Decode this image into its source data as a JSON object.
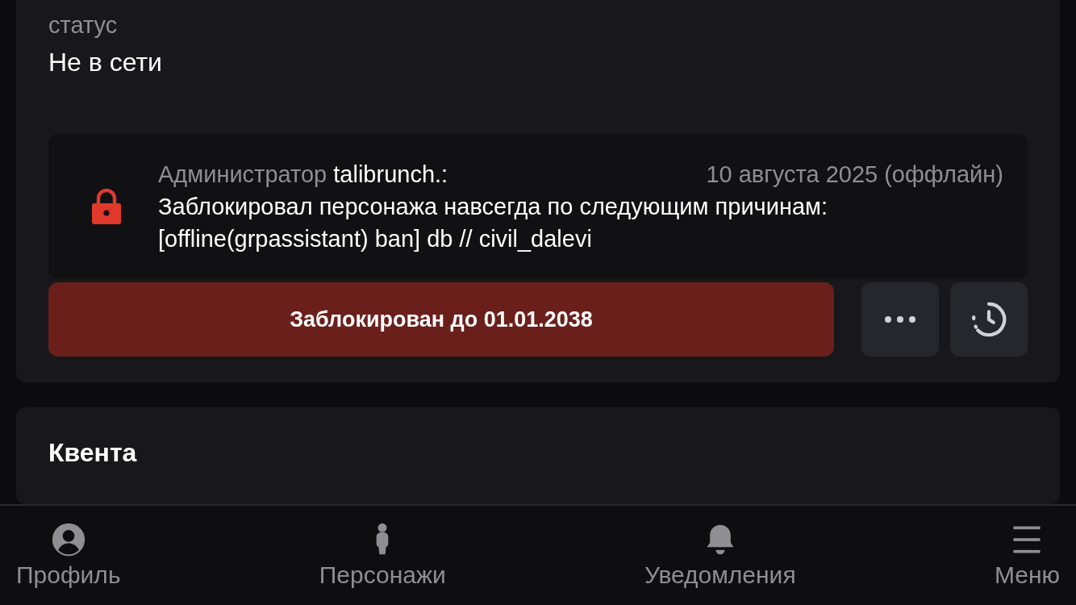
{
  "status": {
    "label": "статус",
    "value": "Не в сети"
  },
  "ban": {
    "role": "Администратор",
    "admin": "talibrunch.:",
    "date": "10 августа 2025 (оффлайн)",
    "message": "Заблокировал персонажа навсегда по следующим причинам:",
    "reason": "[offline(grpassistant) ban] db // civil_dalevi",
    "button": "Заблокирован до 01.01.2038"
  },
  "section": {
    "title": "Квента"
  },
  "nav": [
    {
      "kind": "profile",
      "label": "Профиль"
    },
    {
      "kind": "characters",
      "label": "Персонажи"
    },
    {
      "kind": "notifications",
      "label": "Уведомления"
    },
    {
      "kind": "menu",
      "label": "Меню"
    }
  ]
}
